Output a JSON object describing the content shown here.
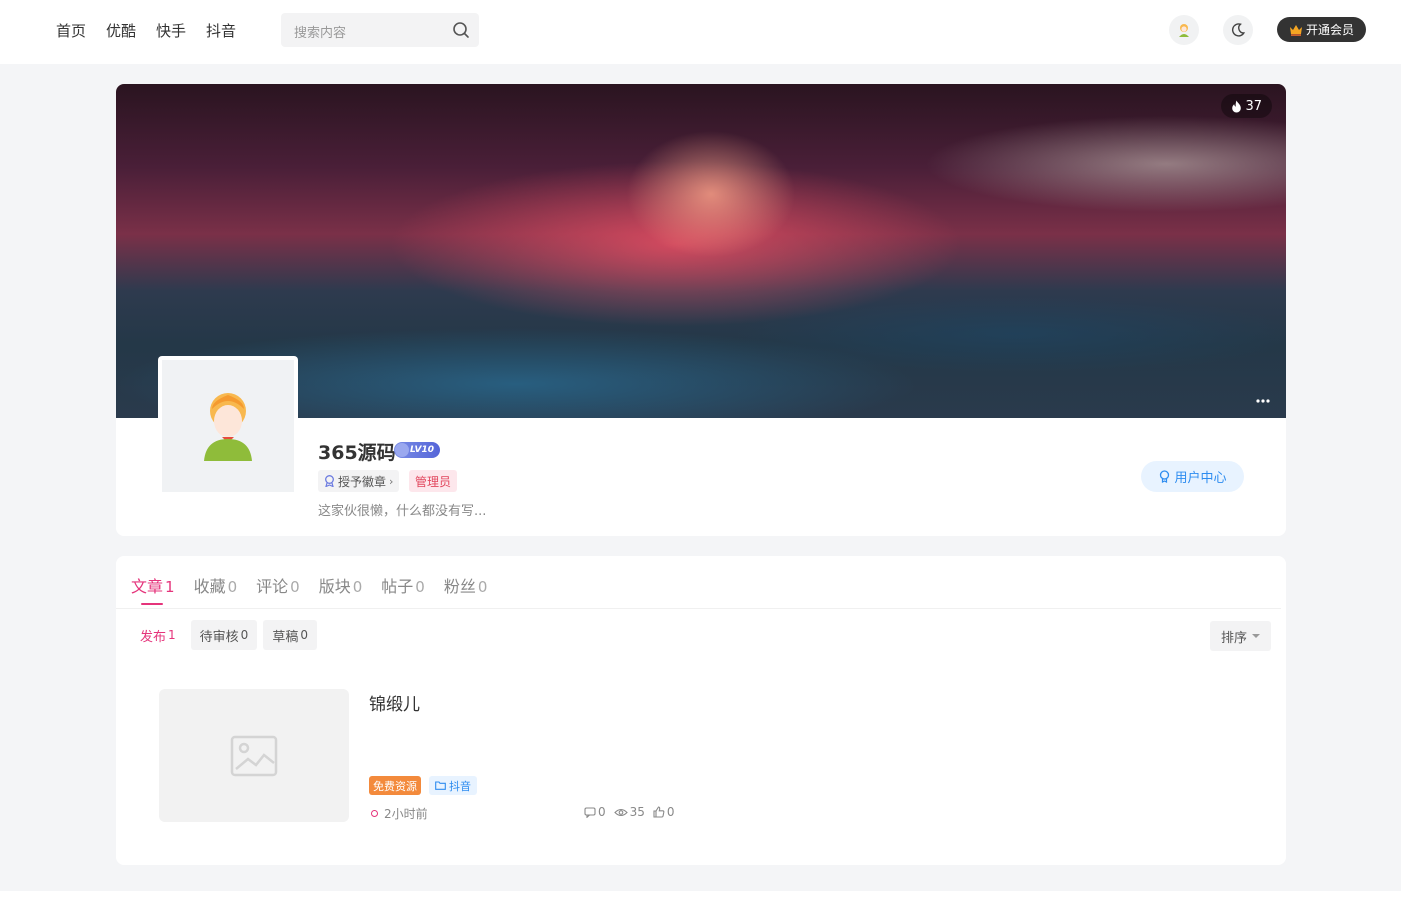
{
  "header": {
    "nav": [
      "首页",
      "优酷",
      "快手",
      "抖音"
    ],
    "search_placeholder": "搜索内容",
    "vip_label": "开通会员"
  },
  "profile": {
    "hot_count": "37",
    "username": "365源码",
    "level": "LV10",
    "medal_label": "授予徽章",
    "role": "管理员",
    "bio": "这家伙很懒，什么都没有写...",
    "user_center_label": "用户中心"
  },
  "tabs": [
    {
      "label": "文章",
      "count": "1",
      "active": true
    },
    {
      "label": "收藏",
      "count": "0"
    },
    {
      "label": "评论",
      "count": "0"
    },
    {
      "label": "版块",
      "count": "0"
    },
    {
      "label": "帖子",
      "count": "0"
    },
    {
      "label": "粉丝",
      "count": "0"
    }
  ],
  "subtabs": [
    {
      "label": "发布",
      "count": "1",
      "active": true
    },
    {
      "label": "待审核",
      "count": "0"
    },
    {
      "label": "草稿",
      "count": "0"
    }
  ],
  "sort_label": "排序",
  "posts": [
    {
      "title": "锦缎儿",
      "badge": "免费资源",
      "category": "抖音",
      "time": "2小时前",
      "comments": "0",
      "views": "35",
      "likes": "0"
    }
  ],
  "icons": {
    "search": "search-icon",
    "theme": "moon-icon",
    "vip": "crown-icon",
    "hot": "fire-icon",
    "more": "more-dots-icon",
    "medal": "medal-icon",
    "user_center": "user-center-icon",
    "image_placeholder": "image-placeholder-icon",
    "folder": "folder-icon",
    "comment": "comment-icon",
    "view": "eye-icon",
    "like": "thumb-up-icon"
  },
  "colors": {
    "accent": "#e5347b",
    "link_blue": "#2d8cf0",
    "badge_orange": "#f38a3c",
    "vip_dark": "#333333"
  }
}
